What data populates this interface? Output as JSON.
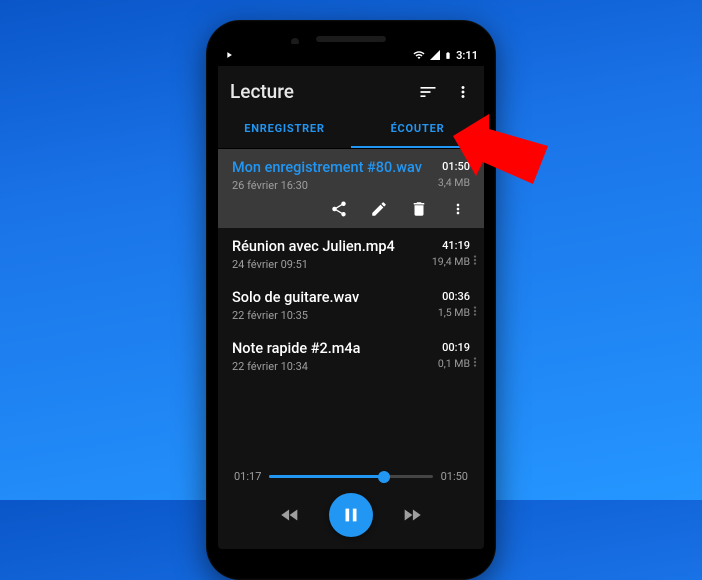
{
  "statusbar": {
    "time": "3:11"
  },
  "appbar": {
    "title": "Lecture"
  },
  "tabs": {
    "record": "ENREGISTRER",
    "listen": "ÉCOUTER"
  },
  "recordings": [
    {
      "title": "Mon enregistrement #80.wav",
      "sub": "26 février 16:30",
      "dur": "01:50",
      "size": "3,4 MB"
    },
    {
      "title": "Réunion avec Julien.mp4",
      "sub": "24 février 09:51",
      "dur": "41:19",
      "size": "19,4 MB"
    },
    {
      "title": "Solo de guitare.wav",
      "sub": "22 février 10:35",
      "dur": "00:36",
      "size": "1,5 MB"
    },
    {
      "title": "Note rapide #2.m4a",
      "sub": "22 février 10:34",
      "dur": "00:19",
      "size": "0,1 MB"
    }
  ],
  "player": {
    "elapsed": "01:17",
    "total": "01:50"
  }
}
